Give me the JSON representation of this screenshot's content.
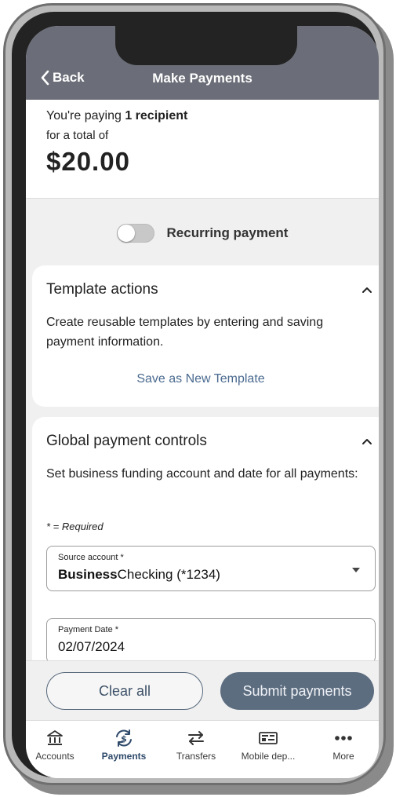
{
  "header": {
    "back_label": "Back",
    "title": "Make Payments"
  },
  "summary": {
    "paying_prefix": "You're paying ",
    "recipient_count_text": "1 recipient",
    "total_label": "for a total of",
    "total_amount": "$20.00"
  },
  "recurring": {
    "label": "Recurring payment",
    "enabled": false
  },
  "template_actions": {
    "title": "Template actions",
    "description": "Create reusable templates by entering and saving payment information.",
    "save_link": "Save as New Template"
  },
  "global_controls": {
    "title": "Global payment controls",
    "description": "Set business funding account and date for all payments:",
    "required_note": "* = Required",
    "source_account": {
      "label": "Source account *",
      "value_bold": "Business",
      "value_rest": "Checking (*1234)"
    },
    "payment_date": {
      "label": "Payment Date *",
      "value": "02/07/2024"
    }
  },
  "actions": {
    "clear_label": "Clear all",
    "submit_label": "Submit payments"
  },
  "tabs": [
    {
      "label": "Accounts",
      "icon": "bank-icon",
      "active": false
    },
    {
      "label": "Payments",
      "icon": "payments-icon",
      "active": true
    },
    {
      "label": "Transfers",
      "icon": "transfer-arrows-icon",
      "active": false
    },
    {
      "label": "Mobile dep...",
      "icon": "check-deposit-icon",
      "active": false
    },
    {
      "label": "More",
      "icon": "more-dots-icon",
      "active": false
    }
  ],
  "colors": {
    "header_bg": "#6b6e78",
    "link": "#4a6a8f",
    "submit_bg": "#5d6d80",
    "active_tab": "#2f4a6a"
  }
}
